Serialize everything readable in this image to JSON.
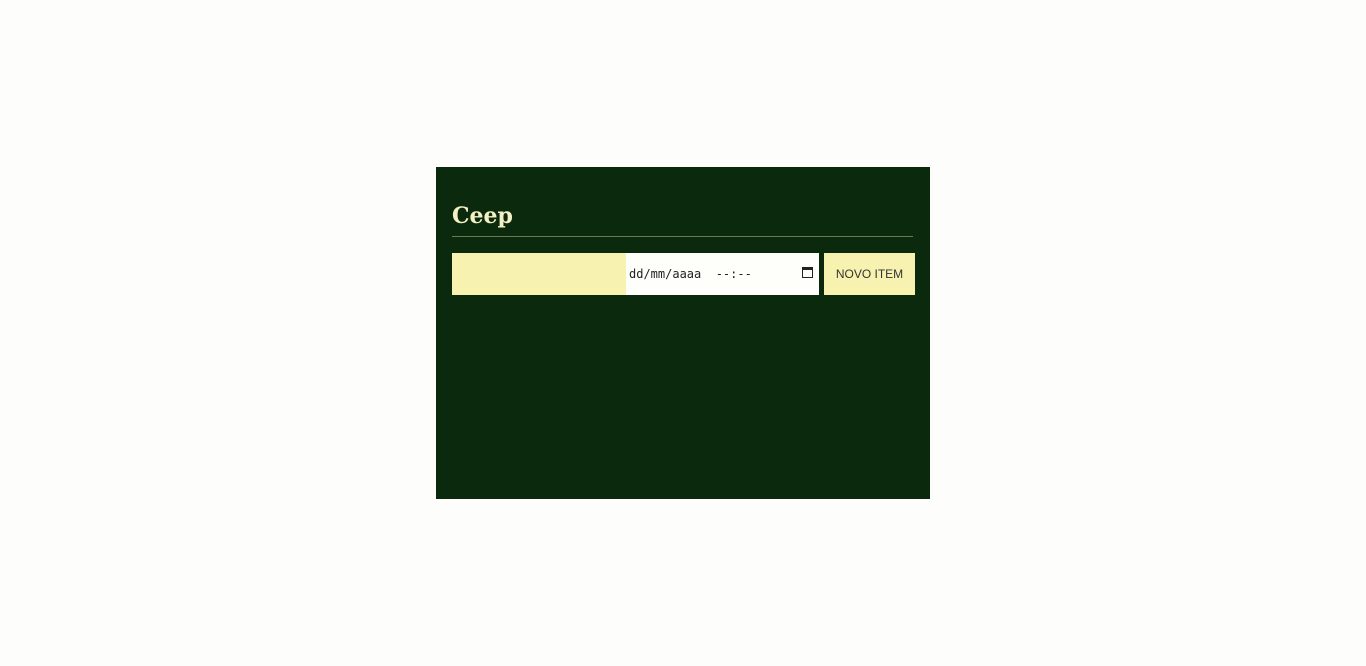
{
  "app": {
    "title": "Ceep"
  },
  "form": {
    "text_value": "",
    "datetime_placeholder": "dd/mm/aaaa  --:--",
    "calendar_icon": "calendar-icon",
    "submit_label": "NOVO ITEM"
  },
  "colors": {
    "card_bg": "#0b2a0d",
    "accent": "#f7f2b0"
  }
}
